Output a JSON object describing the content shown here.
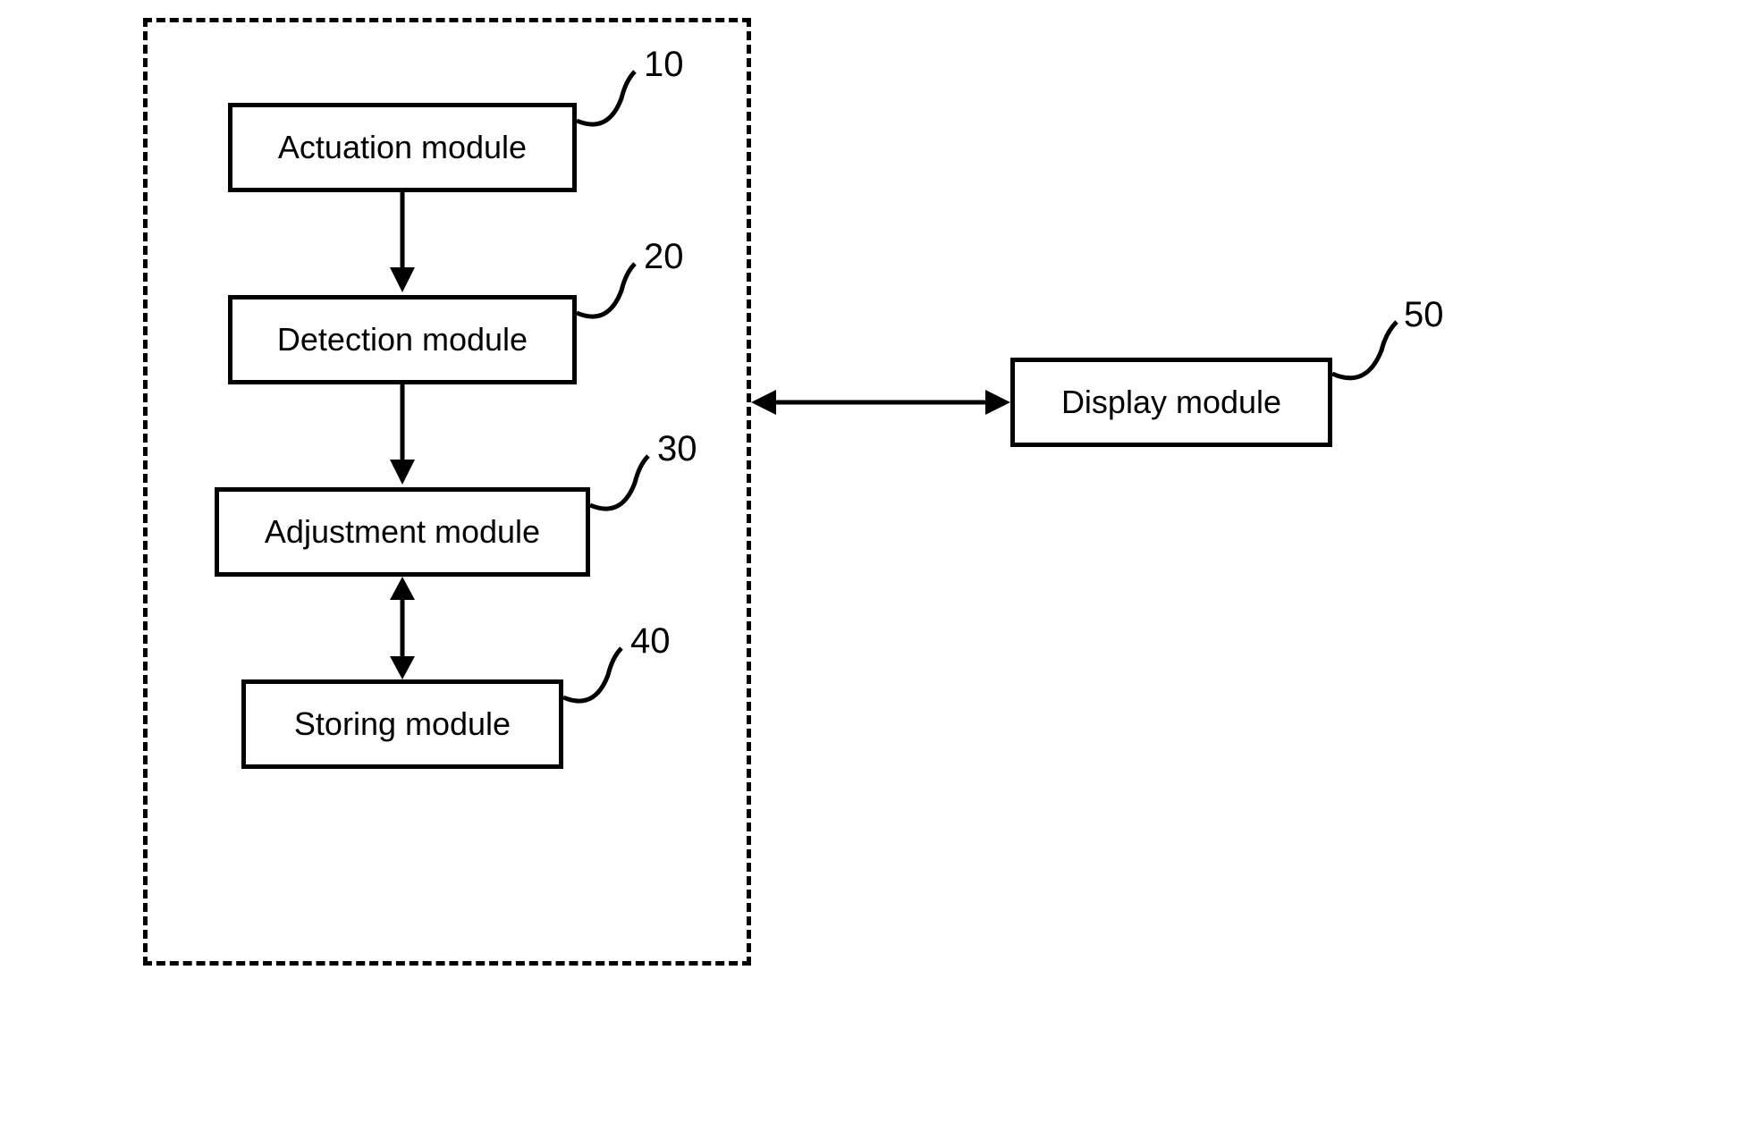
{
  "modules": {
    "actuation": {
      "label": "Actuation module",
      "ref": "10"
    },
    "detection": {
      "label": "Detection module",
      "ref": "20"
    },
    "adjustment": {
      "label": "Adjustment module",
      "ref": "30"
    },
    "storing": {
      "label": "Storing module",
      "ref": "40"
    },
    "display": {
      "label": "Display module",
      "ref": "50"
    }
  }
}
